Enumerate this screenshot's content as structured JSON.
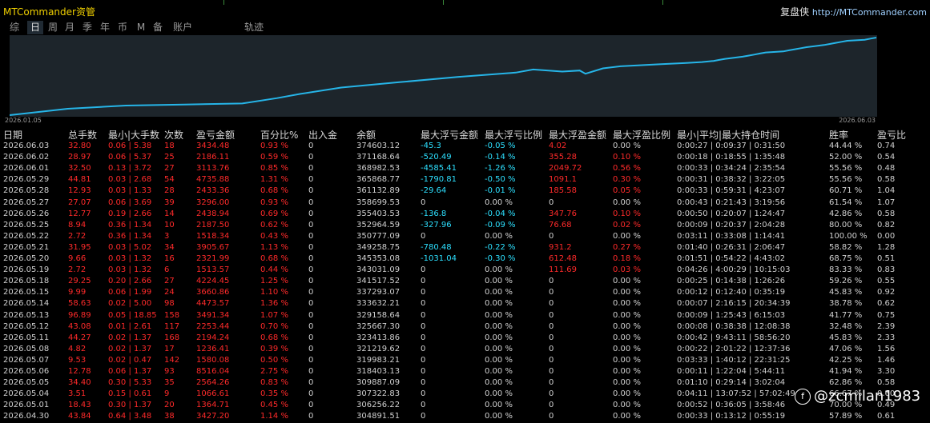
{
  "header": {
    "app_title": "MTCommander资管",
    "brand_name": "复盘侠",
    "brand_url": "http://MTCommander.com"
  },
  "tabs": [
    "综",
    "日",
    "周",
    "月",
    "季",
    "年",
    "币",
    "M",
    "备",
    "账户",
    "轨迹"
  ],
  "active_tab": "日",
  "chart": {
    "x_start": "2026.01.05",
    "x_end": "2026.06.03",
    "line_color": "#26b5e8"
  },
  "chart_data": {
    "type": "line",
    "title": "",
    "xlabel": "",
    "ylabel": "",
    "x_range": [
      "2026.01.05",
      "2026.06.03"
    ],
    "series": [
      {
        "points": [
          [
            "2026.01.05",
            0
          ],
          [
            "2026.01.15",
            6
          ],
          [
            "2026.01.25",
            9
          ],
          [
            "2026.02.04",
            10
          ],
          [
            "2026.02.14",
            11
          ],
          [
            "2026.02.20",
            16
          ],
          [
            "2026.02.24",
            20
          ],
          [
            "2026.03.03",
            26
          ],
          [
            "2026.03.13",
            31
          ],
          [
            "2026.03.23",
            36
          ],
          [
            "2026.04.02",
            40
          ],
          [
            "2026.04.05",
            43
          ],
          [
            "2026.04.10",
            41
          ],
          [
            "2026.04.13",
            42
          ],
          [
            "2026.04.14",
            39
          ],
          [
            "2026.04.17",
            44
          ],
          [
            "2026.04.20",
            46
          ],
          [
            "2026.04.27",
            48
          ],
          [
            "2026.05.01",
            49
          ],
          [
            "2026.05.04",
            50
          ],
          [
            "2026.05.06",
            51
          ],
          [
            "2026.05.07",
            52
          ],
          [
            "2026.05.08",
            53
          ],
          [
            "2026.05.11",
            55
          ],
          [
            "2026.05.12",
            56
          ],
          [
            "2026.05.13",
            57
          ],
          [
            "2026.05.14",
            58
          ],
          [
            "2026.05.15",
            59
          ],
          [
            "2026.05.18",
            60
          ],
          [
            "2026.05.19",
            61
          ],
          [
            "2026.05.20",
            62
          ],
          [
            "2026.05.21",
            63
          ],
          [
            "2026.05.22",
            64
          ],
          [
            "2026.05.25",
            66
          ],
          [
            "2026.05.26",
            67
          ],
          [
            "2026.05.27",
            68
          ],
          [
            "2026.05.28",
            69
          ],
          [
            "2026.05.29",
            70
          ],
          [
            "2026.06.01",
            71
          ],
          [
            "2026.06.02",
            72
          ],
          [
            "2026.06.03",
            73
          ]
        ]
      }
    ]
  },
  "table": {
    "headers": [
      "日期",
      "总手数",
      "最小|大手数",
      "次数",
      "盈亏金额",
      "百分比%",
      "出入金",
      "余额",
      "最大浮亏金额",
      "最大浮亏比例",
      "最大浮盈金额",
      "最大浮盈比例",
      "最小|平均|最大持仓时间",
      "胜率",
      "盈亏比"
    ],
    "rows": [
      [
        "2026.06.03",
        "32.80",
        "0.06 | 5.38",
        "18",
        "3434.48",
        "0.93 %",
        "0",
        "374603.12",
        "-45.3",
        "-0.05 %",
        "4.02",
        "0.00 %",
        "0:00:27 | 0:09:37 | 0:31:50",
        "44.44 %",
        "0.74"
      ],
      [
        "2026.06.02",
        "28.97",
        "0.06 | 5.37",
        "25",
        "2186.11",
        "0.59 %",
        "0",
        "371168.64",
        "-520.49",
        "-0.14 %",
        "355.28",
        "0.10 %",
        "0:00:18 | 0:18:55 | 1:35:48",
        "52.00 %",
        "0.54"
      ],
      [
        "2026.06.01",
        "32.50",
        "0.13 | 3.72",
        "27",
        "3113.76",
        "0.85 %",
        "0",
        "368982.53",
        "-4585.41",
        "-1.26 %",
        "2049.72",
        "0.56 %",
        "0:00:33 | 0:34:24 | 2:35:54",
        "55.56 %",
        "0.48"
      ],
      [
        "2026.05.29",
        "44.81",
        "0.03 | 2.68",
        "54",
        "4735.88",
        "1.31 %",
        "0",
        "365868.77",
        "-1790.81",
        "-0.50 %",
        "1091.1",
        "0.30 %",
        "0:00:31 | 0:38:32 | 3:22:05",
        "55.56 %",
        "0.58"
      ],
      [
        "2026.05.28",
        "12.93",
        "0.03 | 1.33",
        "28",
        "2433.36",
        "0.68 %",
        "0",
        "361132.89",
        "-29.64",
        "-0.01 %",
        "185.58",
        "0.05 %",
        "0:00:33 | 0:59:31 | 4:23:07",
        "60.71 %",
        "1.04"
      ],
      [
        "2026.05.27",
        "27.07",
        "0.06 | 3.69",
        "39",
        "3296.00",
        "0.93 %",
        "0",
        "358699.53",
        "0",
        "0.00 %",
        "0",
        "0.00 %",
        "0:00:43 | 0:21:43 | 3:19:56",
        "61.54 %",
        "1.07"
      ],
      [
        "2026.05.26",
        "12.77",
        "0.19 | 2.66",
        "14",
        "2438.94",
        "0.69 %",
        "0",
        "355403.53",
        "-136.8",
        "-0.04 %",
        "347.76",
        "0.10 %",
        "0:00:50 | 0:20:07 | 1:24:47",
        "42.86 %",
        "0.58"
      ],
      [
        "2026.05.25",
        "8.94",
        "0.36 | 1.34",
        "10",
        "2187.50",
        "0.62 %",
        "0",
        "352964.59",
        "-327.96",
        "-0.09 %",
        "76.68",
        "0.02 %",
        "0:00:09 | 0:20:37 | 2:04:28",
        "80.00 %",
        "0.82"
      ],
      [
        "2026.05.22",
        "2.72",
        "0.36 | 1.34",
        "3",
        "1518.34",
        "0.43 %",
        "0",
        "350777.09",
        "0",
        "0.00 %",
        "0",
        "0.00 %",
        "0:03:11 | 0:33:08 | 1:14:41",
        "100.00 %",
        "0.00"
      ],
      [
        "2026.05.21",
        "31.95",
        "0.03 | 5.02",
        "34",
        "3905.67",
        "1.13 %",
        "0",
        "349258.75",
        "-780.48",
        "-0.22 %",
        "931.2",
        "0.27 %",
        "0:01:40 | 0:26:31 | 2:06:47",
        "58.82 %",
        "1.28"
      ],
      [
        "2026.05.20",
        "9.66",
        "0.03 | 1.32",
        "16",
        "2321.99",
        "0.68 %",
        "0",
        "345353.08",
        "-1031.04",
        "-0.30 %",
        "612.48",
        "0.18 %",
        "0:01:51 | 0:54:22 | 4:43:02",
        "68.75 %",
        "0.51"
      ],
      [
        "2026.05.19",
        "2.72",
        "0.03 | 1.32",
        "6",
        "1513.57",
        "0.44 %",
        "0",
        "343031.09",
        "0",
        "0.00 %",
        "111.69",
        "0.03 %",
        "0:04:26 | 4:00:29 | 10:15:03",
        "83.33 %",
        "0.83"
      ],
      [
        "2026.05.18",
        "29.25",
        "0.20 | 2.66",
        "27",
        "4224.45",
        "1.25 %",
        "0",
        "341517.52",
        "0",
        "0.00 %",
        "0",
        "0.00 %",
        "0:00:25 | 0:14:38 | 1:26:26",
        "59.26 %",
        "0.55"
      ],
      [
        "2026.05.15",
        "9.99",
        "0.06 | 1.99",
        "24",
        "3660.86",
        "1.10 %",
        "0",
        "337293.07",
        "0",
        "0.00 %",
        "0",
        "0.00 %",
        "0:00:12 | 0:12:40 | 0:35:19",
        "45.83 %",
        "0.92"
      ],
      [
        "2026.05.14",
        "58.63",
        "0.02 | 5.00",
        "98",
        "4473.57",
        "1.36 %",
        "0",
        "333632.21",
        "0",
        "0.00 %",
        "0",
        "0.00 %",
        "0:00:07 | 2:16:15 | 20:34:39",
        "38.78 %",
        "0.62"
      ],
      [
        "2026.05.13",
        "96.89",
        "0.05 | 18.85",
        "158",
        "3491.34",
        "1.07 %",
        "0",
        "329158.64",
        "0",
        "0.00 %",
        "0",
        "0.00 %",
        "0:00:09 | 1:25:43 | 6:15:03",
        "41.77 %",
        "0.75"
      ],
      [
        "2026.05.12",
        "43.08",
        "0.01 | 2.61",
        "117",
        "2253.44",
        "0.70 %",
        "0",
        "325667.30",
        "0",
        "0.00 %",
        "0",
        "0.00 %",
        "0:00:08 | 0:38:38 | 12:08:38",
        "32.48 %",
        "2.39"
      ],
      [
        "2026.05.11",
        "44.27",
        "0.02 | 1.37",
        "168",
        "2194.24",
        "0.68 %",
        "0",
        "323413.86",
        "0",
        "0.00 %",
        "0",
        "0.00 %",
        "0:00:42 | 9:43:11 | 58:56:20",
        "45.83 %",
        "2.33"
      ],
      [
        "2026.05.08",
        "4.82",
        "0.02 | 1.37",
        "17",
        "1236.41",
        "0.39 %",
        "0",
        "321219.62",
        "0",
        "0.00 %",
        "0",
        "0.00 %",
        "0:00:22 | 2:01:22 | 12:37:36",
        "47.06 %",
        "1.56"
      ],
      [
        "2026.05.07",
        "9.53",
        "0.02 | 0.47",
        "142",
        "1580.08",
        "0.50 %",
        "0",
        "319983.21",
        "0",
        "0.00 %",
        "0",
        "0.00 %",
        "0:03:33 | 1:40:12 | 22:31:25",
        "42.25 %",
        "1.46"
      ],
      [
        "2026.05.06",
        "12.78",
        "0.06 | 1.37",
        "93",
        "8516.04",
        "2.75 %",
        "0",
        "318403.13",
        "0",
        "0.00 %",
        "0",
        "0.00 %",
        "0:00:11 | 1:22:04 | 5:44:11",
        "41.94 %",
        "3.30"
      ],
      [
        "2026.05.05",
        "34.40",
        "0.30 | 5.33",
        "35",
        "2564.26",
        "0.83 %",
        "0",
        "309887.09",
        "0",
        "0.00 %",
        "0",
        "0.00 %",
        "0:01:10 | 0:29:14 | 3:02:04",
        "62.86 %",
        "0.58"
      ],
      [
        "2026.05.04",
        "3.51",
        "0.15 | 0.61",
        "9",
        "1066.61",
        "0.35 %",
        "0",
        "307322.83",
        "0",
        "0.00 %",
        "0",
        "0.00 %",
        "0:04:11 | 13:07:52 | 57:02:49",
        "66.67 %",
        "0.60"
      ],
      [
        "2026.05.01",
        "18.43",
        "0.30 | 1.37",
        "20",
        "1364.71",
        "0.45 %",
        "0",
        "306256.22",
        "0",
        "0.00 %",
        "0",
        "0.00 %",
        "0:00:52 | 0:36:05 | 3:58:46",
        "70.00 %",
        "0.49"
      ],
      [
        "2026.04.30",
        "43.84",
        "0.64 | 3.48",
        "38",
        "3427.20",
        "1.14 %",
        "0",
        "304891.51",
        "0",
        "0.00 %",
        "0",
        "0.00 %",
        "0:00:33 | 0:13:12 | 0:55:19",
        "57.89 %",
        "0.61"
      ]
    ]
  },
  "colors": {
    "profit": "#ff2a2a",
    "float_loss": "#2de0ff",
    "title": "#f0d000"
  },
  "watermark": {
    "icon": "social-logo-icon",
    "handle": "@zcmilan1983"
  }
}
